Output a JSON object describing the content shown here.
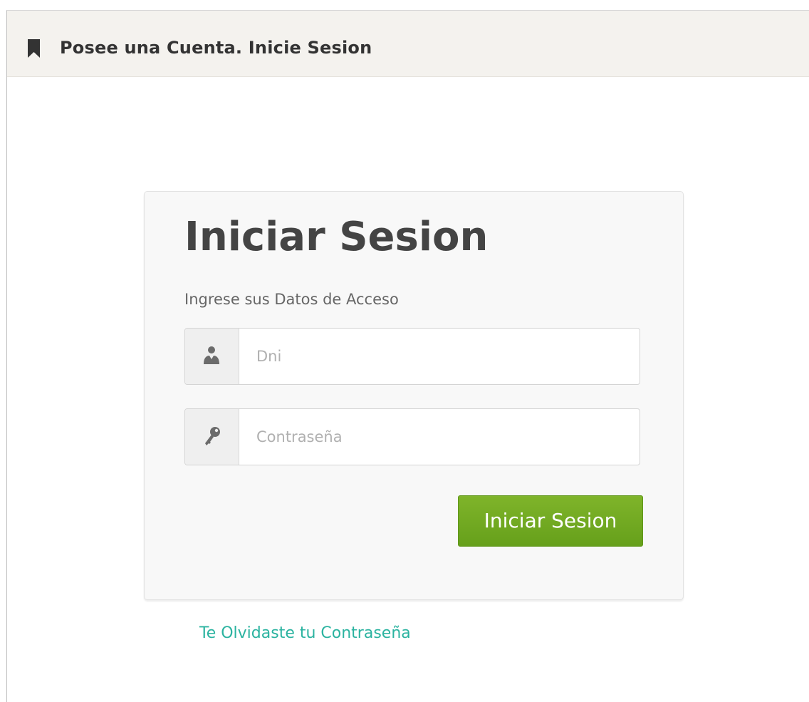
{
  "panel": {
    "title": "Posee una Cuenta. Inicie Sesion",
    "icon": "bookmark-icon"
  },
  "login": {
    "title": "Iniciar Sesion",
    "subtitle": "Ingrese sus Datos de Acceso",
    "dni": {
      "value": "",
      "placeholder": "Dni",
      "icon": "user-icon"
    },
    "password": {
      "value": "",
      "placeholder": "Contraseña",
      "icon": "key-icon"
    },
    "submit_label": "Iniciar Sesion"
  },
  "forgot_link": "Te Olvidaste tu Contraseña",
  "colors": {
    "accent_green": "#6aa51e",
    "link_teal": "#2bb3a0",
    "header_bg": "#f4f2ee"
  }
}
